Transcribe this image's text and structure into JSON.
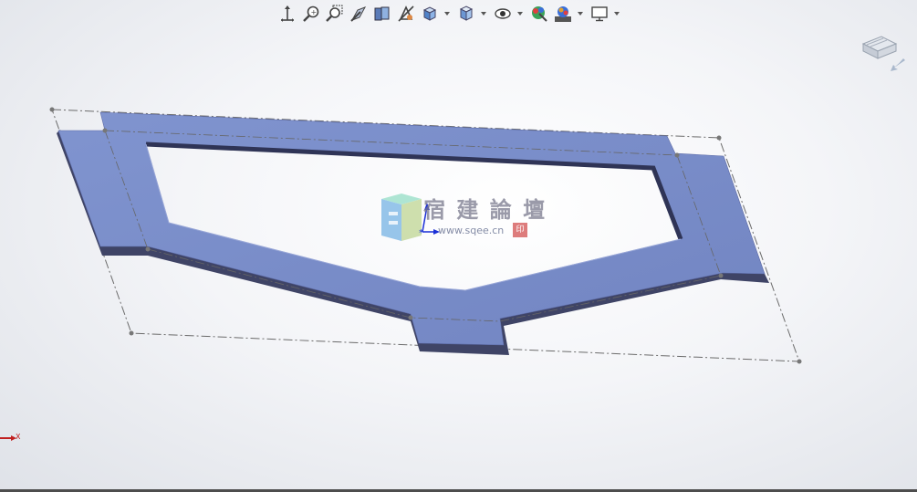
{
  "toolbar": {
    "items": [
      {
        "name": "zoom-to-fit-icon"
      },
      {
        "name": "zoom-to-area-icon"
      },
      {
        "name": "previous-view-icon"
      },
      {
        "name": "section-view-icon"
      },
      {
        "name": "dynamic-annotation-icon"
      },
      {
        "name": "view-setting-icon"
      },
      {
        "name": "view-orientation-icon",
        "dropdown": true
      },
      {
        "name": "display-style-icon",
        "dropdown": true
      },
      {
        "name": "hide-show-items-icon",
        "dropdown": true
      },
      {
        "name": "edit-appearance-icon"
      },
      {
        "name": "apply-scene-icon",
        "dropdown": true
      },
      {
        "name": "view-settings-monitor-icon",
        "dropdown": true
      }
    ]
  },
  "watermark": {
    "text": "宿 建 論 壇",
    "url": "www.sqee.cn",
    "seal": "印"
  },
  "triad": {
    "x_label": "X"
  },
  "colors": {
    "part_top": "#7a8ec8",
    "part_side": "#3f4466",
    "sketch_line": "#666666",
    "accent": "#2a6fd0"
  }
}
